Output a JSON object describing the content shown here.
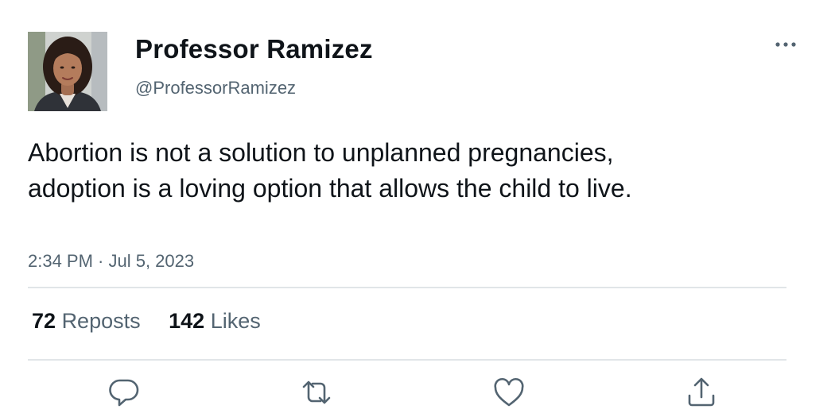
{
  "tweet": {
    "author": {
      "display_name": "Professor Ramizez",
      "handle": "@ProfessorRamizez"
    },
    "text": "Abortion is not a solution to unplanned pregnancies, adoption is a loving option that allows the child to live.",
    "timestamp": "2:34 PM · Jul 5, 2023",
    "stats": {
      "reposts_count": "72",
      "reposts_label": "Reposts",
      "likes_count": "142",
      "likes_label": "Likes"
    },
    "actions": [
      {
        "icon": "reply-icon"
      },
      {
        "icon": "repost-icon"
      },
      {
        "icon": "like-icon"
      },
      {
        "icon": "share-icon"
      }
    ]
  },
  "colors": {
    "text_primary": "#0f1419",
    "text_secondary": "#536471",
    "divider": "#e1e5e8",
    "icon": "#536471"
  }
}
